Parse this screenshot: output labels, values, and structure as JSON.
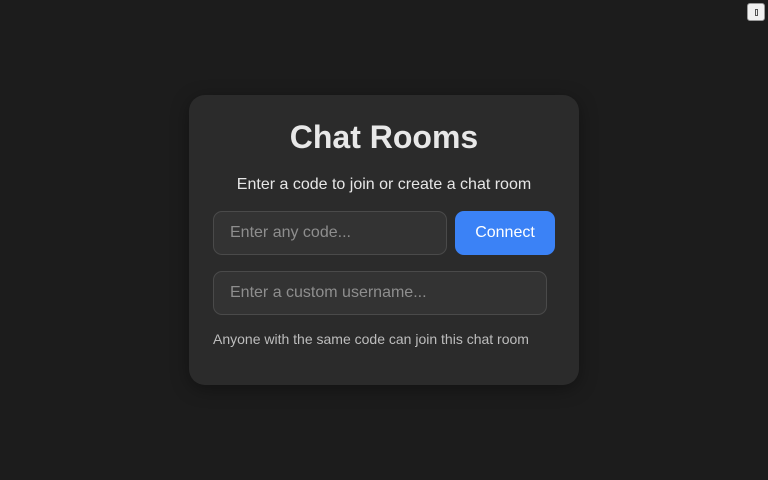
{
  "page": {
    "title": "Chat Rooms",
    "subtitle": "Enter a code to join or create a chat room",
    "hint": "Anyone with the same code can join this chat room"
  },
  "form": {
    "code_placeholder": "Enter any code...",
    "code_value": "",
    "connect_label": "Connect",
    "username_placeholder": "Enter a custom username...",
    "username_value": ""
  },
  "corner": {
    "icon": "missing-glyph-icon"
  },
  "colors": {
    "page_background": "#1c1c1c",
    "card_background": "#2b2b2b",
    "accent": "#3b82f6"
  }
}
